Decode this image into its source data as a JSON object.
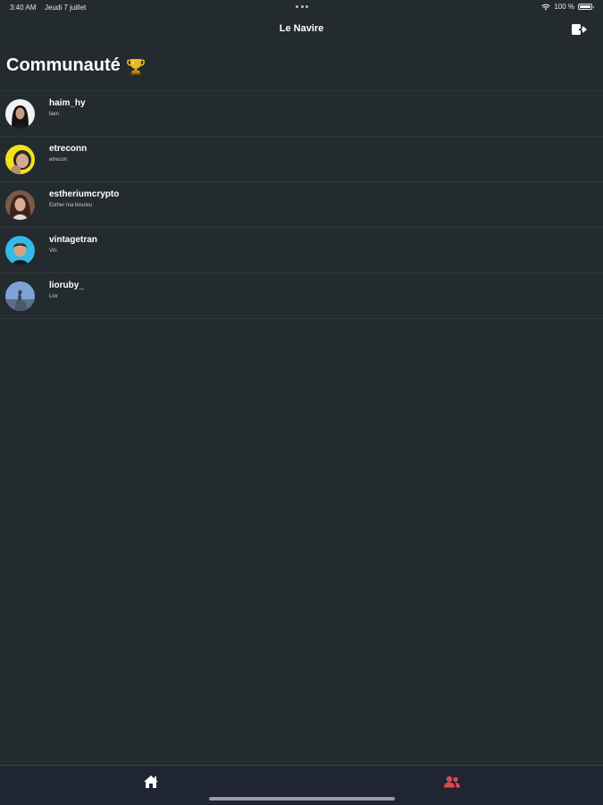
{
  "status_bar": {
    "time": "3:40 AM",
    "date": "Jeudi 7 juillet",
    "battery": "100 %"
  },
  "nav": {
    "title": "Le Navire"
  },
  "page": {
    "title": "Communauté"
  },
  "users": [
    {
      "username": "haim_hy",
      "subtitle": "liam"
    },
    {
      "username": "etreconn",
      "subtitle": "etrecon"
    },
    {
      "username": "estheriumcrypto",
      "subtitle": "Esther ma biouleu"
    },
    {
      "username": "vintagetran",
      "subtitle": "Vin"
    },
    {
      "username": "lioruby_",
      "subtitle": "Lior"
    }
  ],
  "colors": {
    "background": "#232b2e",
    "tab_bar": "#1f2533",
    "active_tab": "#e0484b",
    "inactive_tab": "#ffffff",
    "divider": "#2e383b"
  },
  "tabs": [
    {
      "icon": "home-icon",
      "active": false
    },
    {
      "icon": "community-icon",
      "active": true
    }
  ]
}
